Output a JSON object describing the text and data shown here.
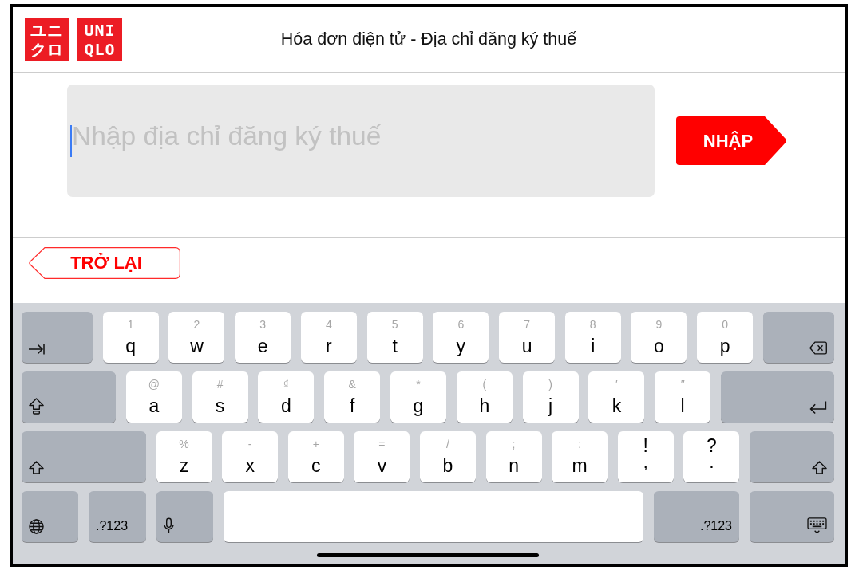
{
  "header": {
    "logo": [
      {
        "lines": [
          "ユニ",
          "クロ"
        ]
      },
      {
        "lines": [
          "UNI",
          "QLO"
        ]
      }
    ],
    "title": "Hóa đơn điện tử - Địa chỉ đăng ký thuế"
  },
  "address_field": {
    "placeholder": "Nhập địa chỉ đăng ký thuế",
    "focused": true
  },
  "submit_button": {
    "label": "NHẬP"
  },
  "back_button": {
    "label": "TRỞ LẠI"
  },
  "keyboard": {
    "rows": [
      {
        "keys": [
          {
            "kind": "tab"
          },
          {
            "kind": "letter",
            "label": "q",
            "alt": "1"
          },
          {
            "kind": "letter",
            "label": "w",
            "alt": "2"
          },
          {
            "kind": "letter",
            "label": "e",
            "alt": "3"
          },
          {
            "kind": "letter",
            "label": "r",
            "alt": "4"
          },
          {
            "kind": "letter",
            "label": "t",
            "alt": "5"
          },
          {
            "kind": "letter",
            "label": "y",
            "alt": "6"
          },
          {
            "kind": "letter",
            "label": "u",
            "alt": "7"
          },
          {
            "kind": "letter",
            "label": "i",
            "alt": "8"
          },
          {
            "kind": "letter",
            "label": "o",
            "alt": "9"
          },
          {
            "kind": "letter",
            "label": "p",
            "alt": "0"
          },
          {
            "kind": "backspace"
          }
        ]
      },
      {
        "keys": [
          {
            "kind": "capslock"
          },
          {
            "kind": "letter",
            "label": "a",
            "alt": "@"
          },
          {
            "kind": "letter",
            "label": "s",
            "alt": "#"
          },
          {
            "kind": "letter",
            "label": "d",
            "alt": "₫"
          },
          {
            "kind": "letter",
            "label": "f",
            "alt": "&"
          },
          {
            "kind": "letter",
            "label": "g",
            "alt": "*"
          },
          {
            "kind": "letter",
            "label": "h",
            "alt": "("
          },
          {
            "kind": "letter",
            "label": "j",
            "alt": ")"
          },
          {
            "kind": "letter",
            "label": "k",
            "alt": "′"
          },
          {
            "kind": "letter",
            "label": "l",
            "alt": "″"
          },
          {
            "kind": "return"
          }
        ]
      },
      {
        "keys": [
          {
            "kind": "shift"
          },
          {
            "kind": "letter",
            "label": "z",
            "alt": "%"
          },
          {
            "kind": "letter",
            "label": "x",
            "alt": "-"
          },
          {
            "kind": "letter",
            "label": "c",
            "alt": "+"
          },
          {
            "kind": "letter",
            "label": "v",
            "alt": "="
          },
          {
            "kind": "letter",
            "label": "b",
            "alt": "/"
          },
          {
            "kind": "letter",
            "label": "n",
            "alt": ";"
          },
          {
            "kind": "letter",
            "label": "m",
            "alt": ":"
          },
          {
            "kind": "punctuation",
            "label": ",",
            "alt": "!"
          },
          {
            "kind": "punctuation",
            "label": ".",
            "alt": "?"
          },
          {
            "kind": "shift"
          }
        ]
      },
      {
        "keys": [
          {
            "kind": "globe"
          },
          {
            "kind": "numbers",
            "label": ".?123"
          },
          {
            "kind": "dictation"
          },
          {
            "kind": "space"
          },
          {
            "kind": "numbers",
            "label": ".?123"
          },
          {
            "kind": "dismiss"
          }
        ]
      }
    ]
  }
}
